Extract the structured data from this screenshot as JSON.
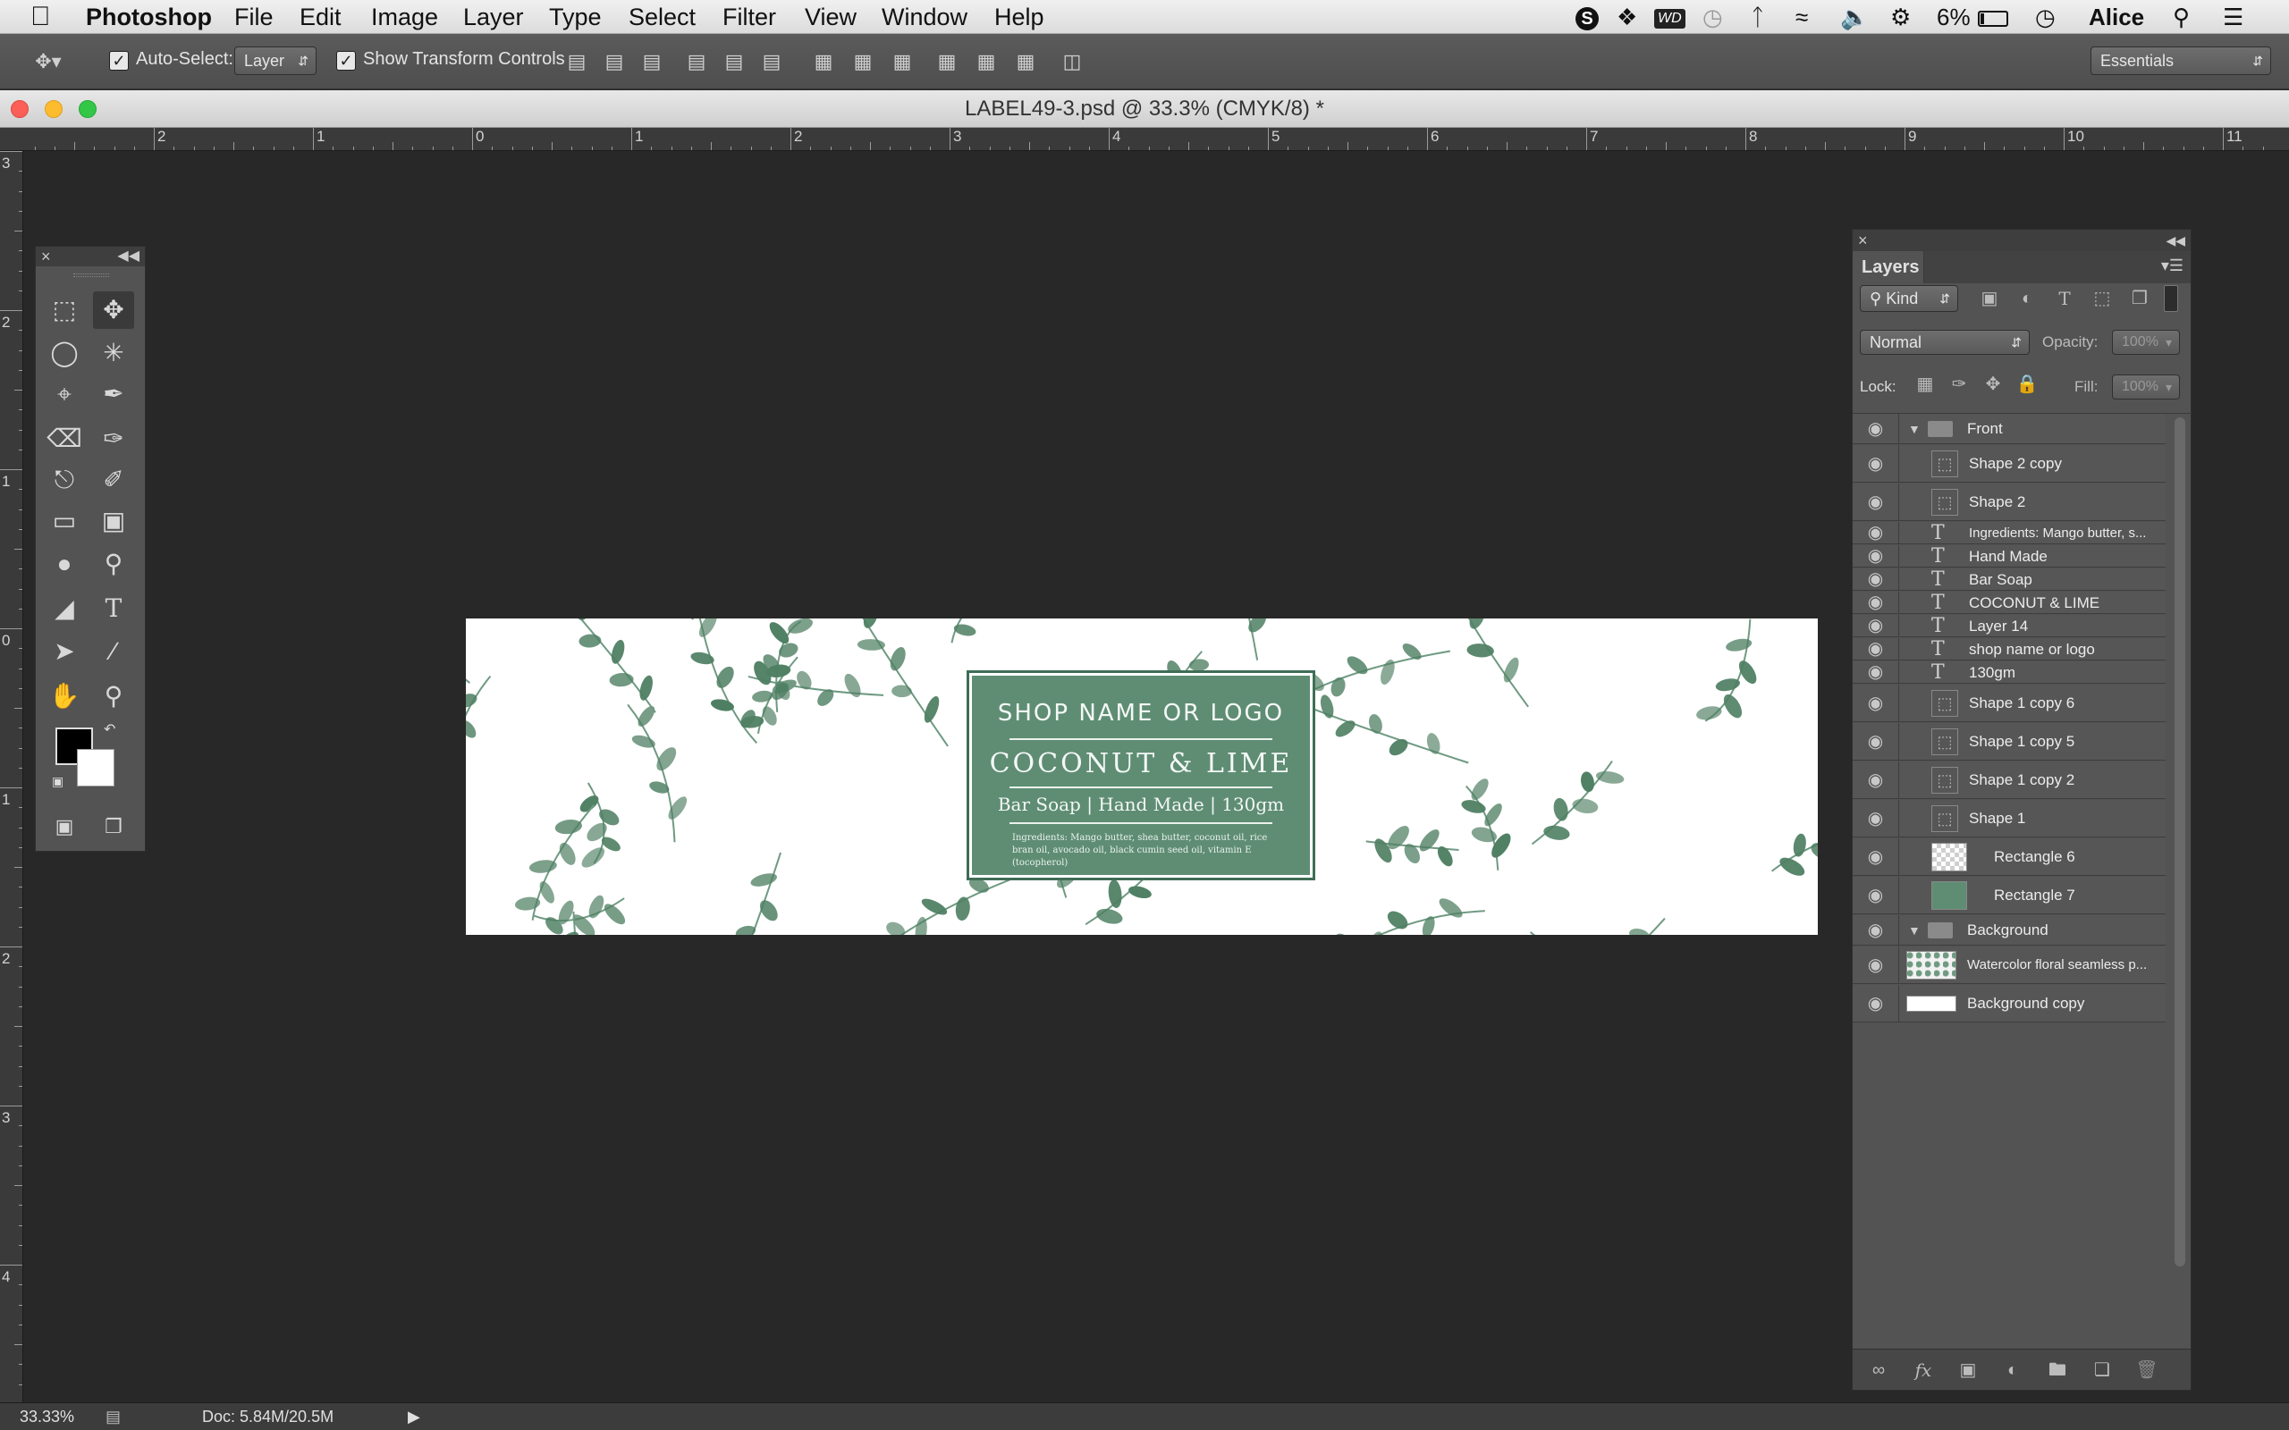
{
  "menubar": {
    "items": [
      "Photoshop",
      "File",
      "Edit",
      "Image",
      "Layer",
      "Type",
      "Select",
      "Filter",
      "View",
      "Window",
      "Help"
    ],
    "battery": "6%",
    "user": "Alice"
  },
  "options": {
    "auto_select_label": "Auto-Select:",
    "auto_select_value": "Layer",
    "transform_label": "Show Transform Controls",
    "workspace": "Essentials"
  },
  "document": {
    "title": "LABEL49-3.psd @ 33.3% (CMYK/8) *"
  },
  "ruler": {
    "h_labels": [
      "2",
      "1",
      "0",
      "1",
      "2",
      "3",
      "4",
      "5",
      "6",
      "7",
      "8",
      "9",
      "10",
      "11"
    ],
    "v_labels": [
      "3",
      "2",
      "1",
      "0",
      "1",
      "2",
      "3",
      "4"
    ]
  },
  "label": {
    "shop_name": "SHOP NAME OR LOGO",
    "product": "COCONUT & LIME",
    "subline": "Bar Soap | Hand Made | 130gm",
    "ingredients": "Ingredients: Mango butter, shea butter, coconut oil, rice bran oil, avocado oil, black cumin seed oil, vitamin E (tocopherol)"
  },
  "layers_panel": {
    "title": "Layers",
    "filter": "Kind",
    "blend_mode": "Normal",
    "opacity_label": "Opacity:",
    "opacity_value": "100%",
    "lock_label": "Lock:",
    "fill_label": "Fill:",
    "fill_value": "100%",
    "layers": [
      {
        "name": "Front",
        "kind": "group"
      },
      {
        "name": "Shape 2 copy",
        "kind": "shape"
      },
      {
        "name": "Shape 2",
        "kind": "shape"
      },
      {
        "name": "Ingredients: Mango butter, s...",
        "kind": "text"
      },
      {
        "name": "Hand Made",
        "kind": "text"
      },
      {
        "name": "Bar Soap",
        "kind": "text"
      },
      {
        "name": "COCONUT & LIME",
        "kind": "text"
      },
      {
        "name": "Layer 14",
        "kind": "text"
      },
      {
        "name": "shop name or logo",
        "kind": "text"
      },
      {
        "name": "130gm",
        "kind": "text"
      },
      {
        "name": "Shape 1 copy 6",
        "kind": "shape"
      },
      {
        "name": "Shape 1 copy 5",
        "kind": "shape"
      },
      {
        "name": "Shape 1 copy 2",
        "kind": "shape"
      },
      {
        "name": "Shape 1",
        "kind": "shape"
      },
      {
        "name": "Rectangle 6",
        "kind": "rect-transparent"
      },
      {
        "name": "Rectangle 7",
        "kind": "rect-green"
      },
      {
        "name": "Background",
        "kind": "group"
      },
      {
        "name": "Watercolor floral seamless p...",
        "kind": "image"
      },
      {
        "name": "Background copy",
        "kind": "fill-white"
      }
    ]
  },
  "status": {
    "zoom": "33.33%",
    "doc": "Doc: 5.84M/20.5M"
  },
  "colors": {
    "label_green": "#5e8d74",
    "leaf_green": "#4f7f63",
    "canvas_bg": "#282828"
  }
}
